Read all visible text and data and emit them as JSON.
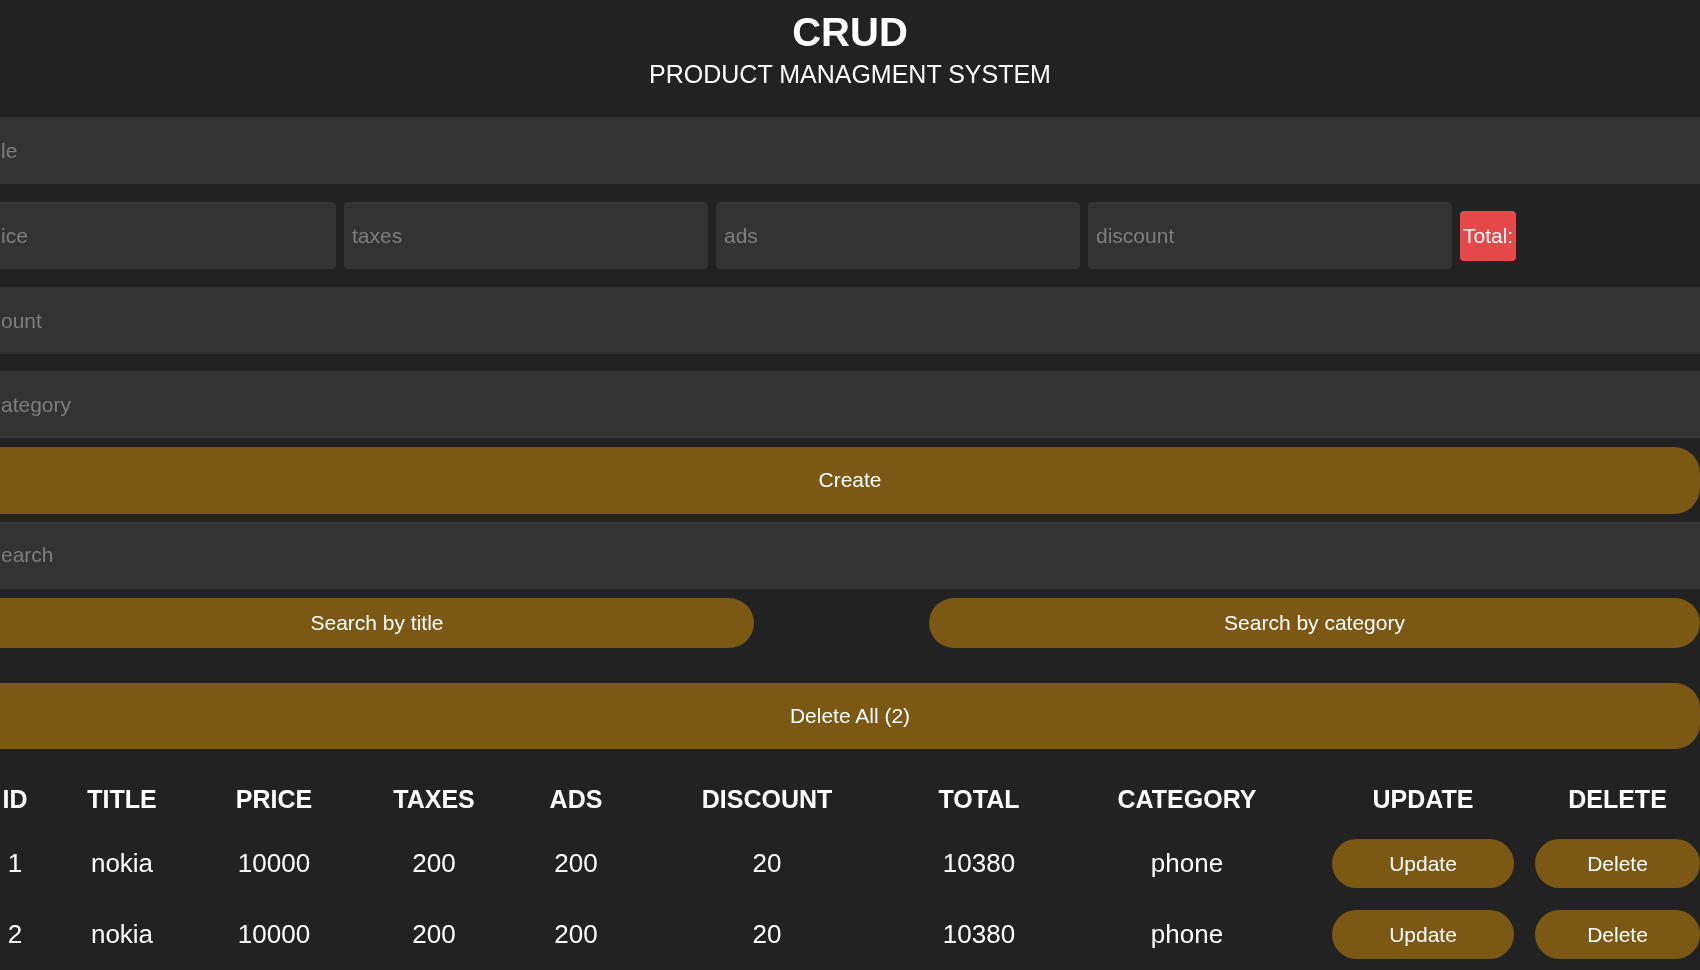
{
  "header": {
    "title": "CRUD",
    "subtitle": "PRODUCT MANAGMENT SYSTEM"
  },
  "form": {
    "title_field": {
      "placeholder": "le"
    },
    "cost_fields": [
      {
        "placeholder": "ice"
      },
      {
        "placeholder": "taxes"
      },
      {
        "placeholder": "ads"
      },
      {
        "placeholder": "discount"
      }
    ],
    "total": "Total:",
    "count_field": {
      "placeholder": "ount"
    },
    "category_field": {
      "placeholder": "ategory"
    },
    "create_button": "Create"
  },
  "search": {
    "field": {
      "placeholder": "earch"
    },
    "buttons": [
      "Search by title",
      "Search by category"
    ]
  },
  "delete_all_button": "Delete All (2)",
  "table": {
    "columns": [
      "ID",
      "TITLE",
      "PRICE",
      "TAXES",
      "ADS",
      "DISCOUNT",
      "TOTAL",
      "CATEGORY",
      "UPDATE",
      "DELETE"
    ],
    "rows": [
      {
        "cells": [
          "1",
          "nokia",
          "10000",
          "200",
          "200",
          "20",
          "10380",
          "phone"
        ],
        "update": "Update",
        "delete": "Delete"
      },
      {
        "cells": [
          "2",
          "nokia",
          "10000",
          "200",
          "200",
          "20",
          "10380",
          "phone"
        ],
        "update": "Update",
        "delete": "Delete"
      }
    ]
  }
}
